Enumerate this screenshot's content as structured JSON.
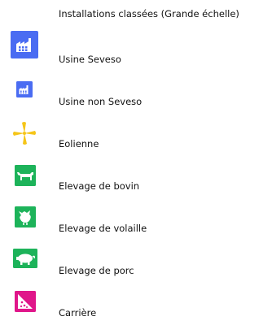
{
  "legend": {
    "title": "Installations classées (Grande échelle)",
    "items": [
      {
        "label": "Usine Seveso",
        "icon": "seveso-factory-icon",
        "color": "#4a6cf2"
      },
      {
        "label": "Usine non Seveso",
        "icon": "factory-icon",
        "color": "#4a6cf2"
      },
      {
        "label": "Eolienne",
        "icon": "wind-turbine-icon",
        "color": "#f5c518"
      },
      {
        "label": "Elevage de bovin",
        "icon": "cow-icon",
        "color": "#1db35a"
      },
      {
        "label": "Elevage de volaille",
        "icon": "chicken-icon",
        "color": "#1db35a"
      },
      {
        "label": "Elevage de porc",
        "icon": "pig-icon",
        "color": "#1db35a"
      },
      {
        "label": "Carrière",
        "icon": "quarry-icon",
        "color": "#e0168a"
      }
    ]
  }
}
